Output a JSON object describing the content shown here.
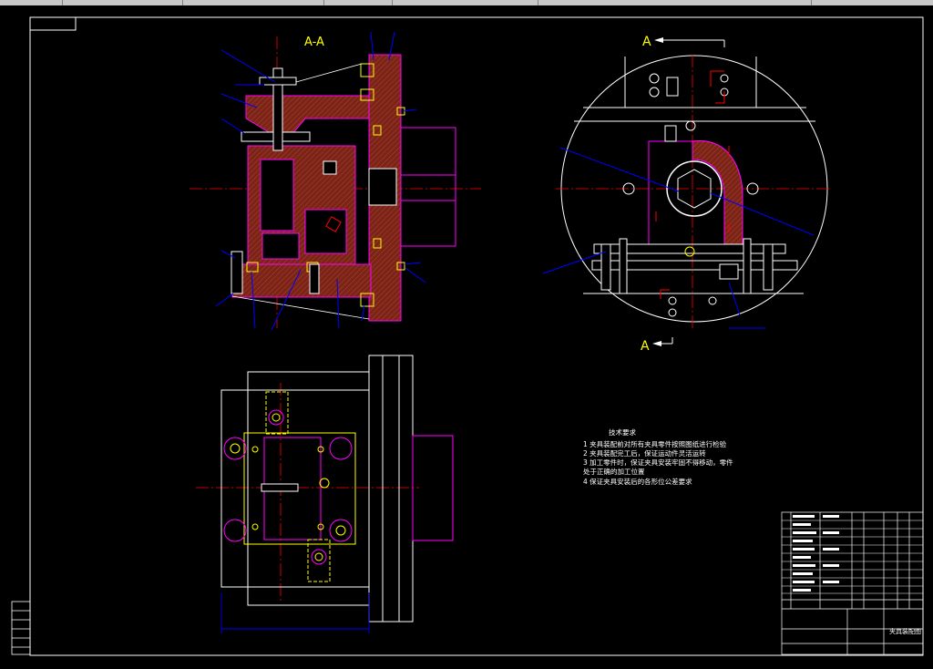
{
  "drawing": {
    "section_label": "A-A",
    "view_arrow_top": "A",
    "view_arrow_bottom": "A",
    "title_block_name": "夹具装配图"
  },
  "notes": {
    "heading": "技术要求",
    "lines": [
      "1 夹具装配前对所有夹具零件按照图纸进行检验",
      "2 夹具装配完工后，保证运动件灵活运转",
      "3 加工零件时，保证夹具安装牢固不得移动，零件",
      "   处于正确的加工位置",
      "4 保证夹具安装后的各形位公差要求"
    ]
  },
  "colors": {
    "frame": "#ffffff",
    "part_outline": "#ff00ff",
    "section_fill": "#8b2a20",
    "bolt": "#ffff00",
    "centerline": "#ff0000",
    "leader": "#0000ff",
    "circle_view": "#ffffff"
  }
}
